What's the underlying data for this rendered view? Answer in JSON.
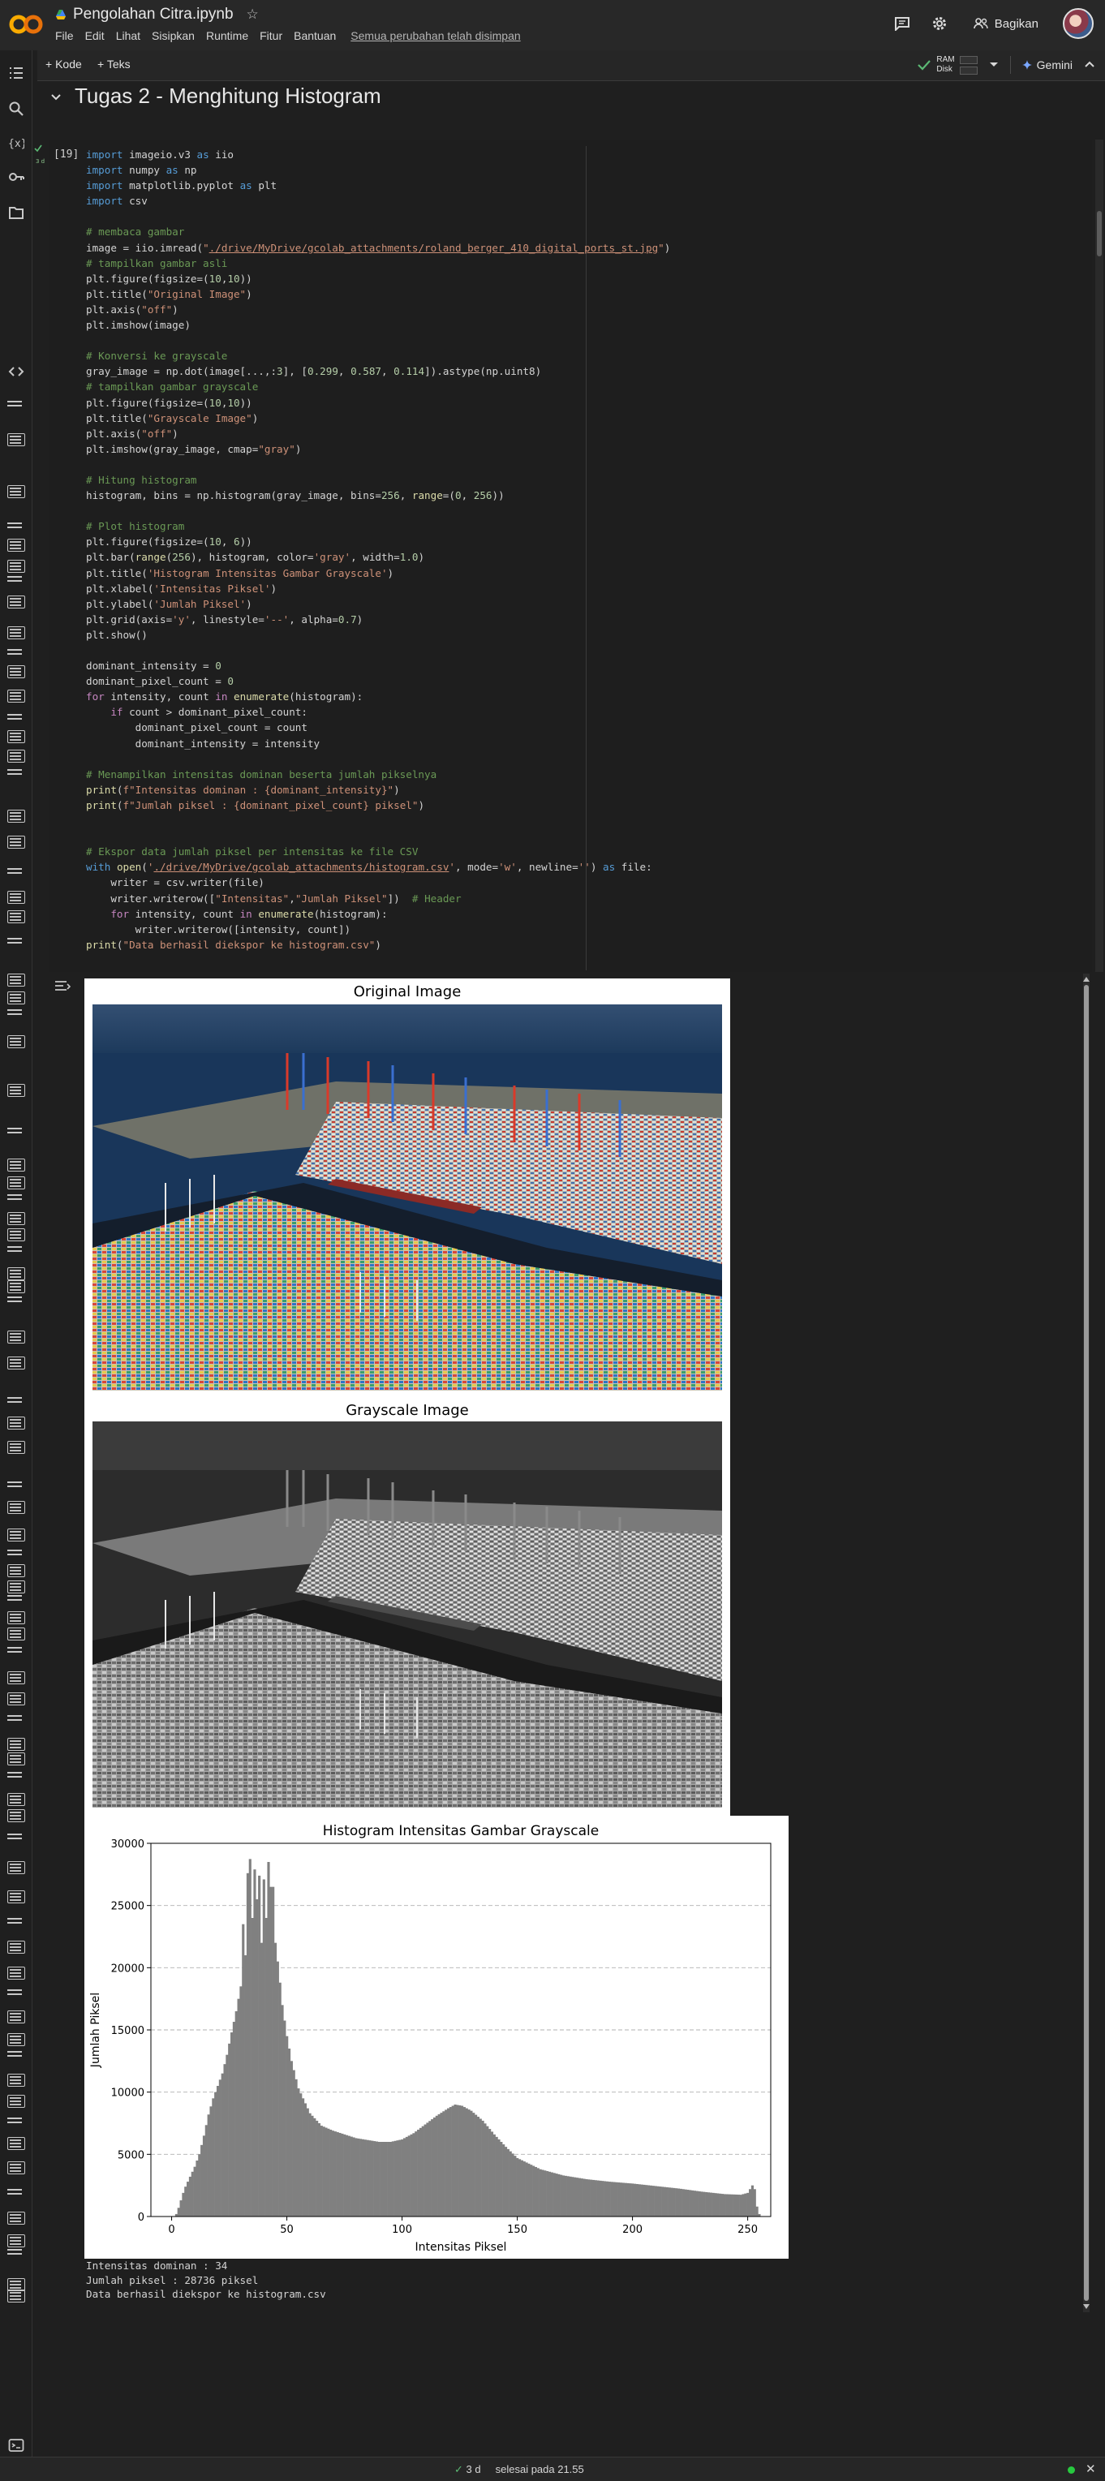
{
  "header": {
    "notebook_title": "Pengolahan Citra.ipynb",
    "menu": [
      "File",
      "Edit",
      "Lihat",
      "Sisipkan",
      "Runtime",
      "Fitur",
      "Bantuan"
    ],
    "saved_status": "Semua perubahan telah disimpan",
    "share_label": "Bagikan"
  },
  "toolbar": {
    "add_code": "+ Kode",
    "add_text": "+ Teks",
    "ram_label": "RAM",
    "disk_label": "Disk",
    "gemini_label": "Gemini"
  },
  "section": {
    "title": "Tugas 2 - Menghitung Histogram"
  },
  "cell": {
    "execution_count": "[19]",
    "run_time": "3 d",
    "code_lines": [
      "import imageio.v3 as iio",
      "import numpy as np",
      "import matplotlib.pyplot as plt",
      "import csv",
      "",
      "# membaca gambar",
      "image = iio.imread(\"./drive/MyDrive/gcolab_attachments/roland_berger_410_digital_ports_st.jpg\")",
      "# tampilkan gambar asli",
      "plt.figure(figsize=(10,10))",
      "plt.title(\"Original Image\")",
      "plt.axis(\"off\")",
      "plt.imshow(image)",
      "",
      "# Konversi ke grayscale",
      "gray_image = np.dot(image[...,:3], [0.299, 0.587, 0.114]).astype(np.uint8)",
      "# tampilkan gambar grayscale",
      "plt.figure(figsize=(10,10))",
      "plt.title(\"Grayscale Image\")",
      "plt.axis(\"off\")",
      "plt.imshow(gray_image, cmap=\"gray\")",
      "",
      "# Hitung histogram",
      "histogram, bins = np.histogram(gray_image, bins=256, range=(0, 256))",
      "",
      "# Plot histogram",
      "plt.figure(figsize=(10, 6))",
      "plt.bar(range(256), histogram, color='gray', width=1.0)",
      "plt.title('Histogram Intensitas Gambar Grayscale')",
      "plt.xlabel('Intensitas Piksel')",
      "plt.ylabel('Jumlah Piksel')",
      "plt.grid(axis='y', linestyle='--', alpha=0.7)",
      "plt.show()",
      "",
      "dominant_intensity = 0",
      "dominant_pixel_count = 0",
      "for intensity, count in enumerate(histogram):",
      "    if count > dominant_pixel_count:",
      "        dominant_pixel_count = count",
      "        dominant_intensity = intensity",
      "",
      "# Menampilkan intensitas dominan beserta jumlah pikselnya",
      "print(f\"Intensitas dominan : {dominant_intensity}\")",
      "print(f\"Jumlah piksel : {dominant_pixel_count} piksel\")",
      "",
      "",
      "# Ekspor data jumlah piksel per intensitas ke file CSV",
      "with open('./drive/MyDrive/gcolab_attachments/histogram.csv', mode='w', newline='') as file:",
      "    writer = csv.writer(file)",
      "    writer.writerow([\"Intensitas\",\"Jumlah Piksel\"])  # Header",
      "    for intensity, count in enumerate(histogram):",
      "        writer.writerow([intensity, count])",
      "print(\"Data berhasil diekspor ke histogram.csv\")"
    ]
  },
  "figures": {
    "original_title": "Original Image",
    "gray_title": "Grayscale Image"
  },
  "chart_data": {
    "type": "bar",
    "title": "Histogram Intensitas Gambar Grayscale",
    "xlabel": "Intensitas Piksel",
    "ylabel": "Jumlah Piksel",
    "xlim": [
      -9,
      260
    ],
    "ylim": [
      0,
      30000
    ],
    "xticks": [
      0,
      50,
      100,
      150,
      200,
      250
    ],
    "yticks": [
      0,
      5000,
      10000,
      15000,
      20000,
      25000,
      30000
    ],
    "grid": "y dashed",
    "color": "#808080",
    "anchors": [
      [
        0,
        0
      ],
      [
        1,
        0
      ],
      [
        2,
        200
      ],
      [
        3,
        700
      ],
      [
        4,
        1300
      ],
      [
        5,
        1900
      ],
      [
        6,
        2400
      ],
      [
        7,
        2800
      ],
      [
        8,
        3200
      ],
      [
        9,
        3600
      ],
      [
        10,
        4000
      ],
      [
        12,
        5000
      ],
      [
        14,
        6500
      ],
      [
        16,
        8200
      ],
      [
        18,
        9500
      ],
      [
        20,
        10500
      ],
      [
        22,
        11500
      ],
      [
        24,
        13000
      ],
      [
        26,
        14800
      ],
      [
        28,
        16500
      ],
      [
        30,
        18500
      ],
      [
        31,
        20000
      ],
      [
        32,
        22000
      ],
      [
        33,
        26500
      ],
      [
        34,
        28736
      ],
      [
        35,
        24000
      ],
      [
        36,
        28200
      ],
      [
        37,
        25500
      ],
      [
        38,
        26800
      ],
      [
        39,
        22000
      ],
      [
        40,
        27500
      ],
      [
        41,
        24000
      ],
      [
        42,
        28300
      ],
      [
        43,
        26500
      ],
      [
        44,
        25000
      ],
      [
        45,
        22000
      ],
      [
        46,
        20500
      ],
      [
        47,
        18800
      ],
      [
        48,
        17000
      ],
      [
        50,
        14500
      ],
      [
        52,
        12500
      ],
      [
        55,
        10300
      ],
      [
        60,
        8300
      ],
      [
        65,
        7300
      ],
      [
        70,
        6900
      ],
      [
        80,
        6300
      ],
      [
        90,
        6000
      ],
      [
        95,
        6000
      ],
      [
        100,
        6200
      ],
      [
        105,
        6700
      ],
      [
        110,
        7400
      ],
      [
        115,
        8100
      ],
      [
        120,
        8700
      ],
      [
        123,
        9000
      ],
      [
        126,
        8900
      ],
      [
        130,
        8500
      ],
      [
        135,
        7700
      ],
      [
        140,
        6600
      ],
      [
        145,
        5600
      ],
      [
        150,
        4700
      ],
      [
        160,
        3800
      ],
      [
        170,
        3300
      ],
      [
        180,
        3000
      ],
      [
        190,
        2800
      ],
      [
        200,
        2650
      ],
      [
        210,
        2450
      ],
      [
        220,
        2250
      ],
      [
        230,
        2000
      ],
      [
        240,
        1800
      ],
      [
        247,
        1750
      ],
      [
        250,
        1900
      ],
      [
        252,
        2500
      ],
      [
        253,
        2200
      ],
      [
        254,
        800
      ],
      [
        255,
        200
      ]
    ],
    "spikes": [
      [
        29,
        17500
      ],
      [
        31,
        23500
      ],
      [
        32,
        21000
      ],
      [
        33,
        27600
      ],
      [
        36,
        27900
      ],
      [
        38,
        27400
      ],
      [
        40,
        27100
      ],
      [
        42,
        28500
      ],
      [
        44,
        26500
      ]
    ]
  },
  "output_lines": [
    "Intensitas dominan : 34",
    "Jumlah piksel : 28736 piksel",
    "Data berhasil diekspor ke histogram.csv"
  ],
  "status": {
    "check": "✓",
    "duration": "3 d",
    "finished": "selesai pada 21.55"
  }
}
